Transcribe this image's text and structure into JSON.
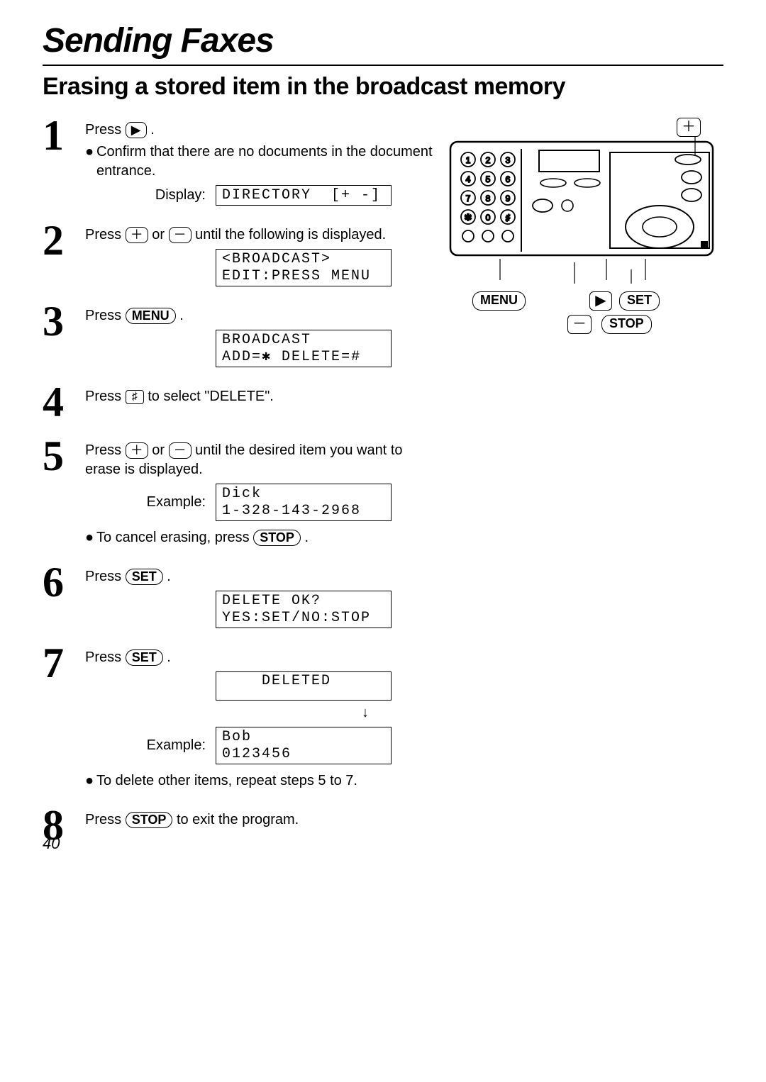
{
  "page": {
    "chapter_title": "Sending Faxes",
    "section_title": "Erasing a stored item in the broadcast memory",
    "page_number": "40"
  },
  "buttons": {
    "play": "▶",
    "plus": "＋",
    "minus": "－",
    "hash": "♯",
    "menu": "MENU",
    "set": "SET",
    "stop": "STOP"
  },
  "steps": {
    "1": {
      "num": "1",
      "text_a": "Press ",
      "text_b": " .",
      "bullet": "Confirm that there are no documents in the document entrance.",
      "display_label": "Display:",
      "display": "DIRECTORY  [+ -]"
    },
    "2": {
      "num": "2",
      "text_a": "Press ",
      "text_mid": " or ",
      "text_b": " until the following is displayed.",
      "display": "<BROADCAST>\nEDIT:PRESS MENU"
    },
    "3": {
      "num": "3",
      "text_a": "Press ",
      "text_b": " .",
      "display": "BROADCAST\nADD=✱ DELETE=#"
    },
    "4": {
      "num": "4",
      "text_a": "Press ",
      "text_b": " to select \"DELETE\"."
    },
    "5": {
      "num": "5",
      "text_a": "Press ",
      "text_mid": " or ",
      "text_b": " until the desired item you want to erase is displayed.",
      "display_label": "Example:",
      "display": "Dick\n1-328-143-2968",
      "bullet_a": "To cancel erasing, press ",
      "bullet_b": " ."
    },
    "6": {
      "num": "6",
      "text_a": "Press ",
      "text_b": " .",
      "display": "DELETE OK?\nYES:SET/NO:STOP"
    },
    "7": {
      "num": "7",
      "text_a": "Press ",
      "text_b": " .",
      "display1": "    DELETED",
      "display_label": "Example:",
      "display2": "Bob\n0123456",
      "bullet": "To delete other items, repeat steps 5 to 7."
    },
    "8": {
      "num": "8",
      "text_a": "Press ",
      "text_b": " to exit the program."
    }
  },
  "figure": {
    "callout_menu": "MENU",
    "callout_play": "▶",
    "callout_set": "SET",
    "callout_minus": "－",
    "callout_stop": "STOP",
    "callout_plus": "＋"
  }
}
